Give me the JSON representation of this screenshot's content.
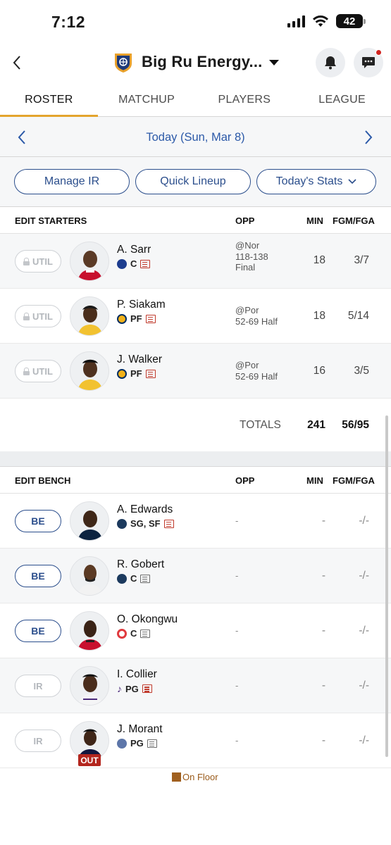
{
  "status_bar": {
    "time": "7:12",
    "battery": "42"
  },
  "header": {
    "team_name": "Big Ru Energy..."
  },
  "tabs": [
    {
      "label": "ROSTER",
      "active": true
    },
    {
      "label": "MATCHUP"
    },
    {
      "label": "PLAYERS"
    },
    {
      "label": "LEAGUE"
    }
  ],
  "date_nav": {
    "label": "Today (Sun, Mar 8)"
  },
  "actions": {
    "manage_ir": "Manage IR",
    "quick_lineup": "Quick Lineup",
    "todays_stats": "Today's Stats"
  },
  "starters": {
    "header": {
      "title": "EDIT STARTERS",
      "opp": "OPP",
      "min": "MIN",
      "fgm_fga": "FGM/FGA"
    },
    "rows": [
      {
        "slot": "UTIL",
        "name": "A. Sarr",
        "pos": "C",
        "team_color": "#1d3d8f",
        "opp_line1": "@Nor",
        "opp_line2": "118-138",
        "opp_line3": "Final",
        "min": "18",
        "fg": "3/7"
      },
      {
        "slot": "UTIL",
        "name": "P. Siakam",
        "pos": "PF",
        "team_color": "#f2b21a",
        "opp_line1": "@Por",
        "opp_line2": "52-69 Half",
        "opp_line3": "",
        "min": "18",
        "fg": "5/14"
      },
      {
        "slot": "UTIL",
        "name": "J. Walker",
        "pos": "PF",
        "team_color": "#f2b21a",
        "opp_line1": "@Por",
        "opp_line2": "52-69 Half",
        "opp_line3": "",
        "min": "16",
        "fg": "3/5"
      }
    ],
    "totals": {
      "label": "TOTALS",
      "min": "241",
      "fg": "56/95"
    }
  },
  "bench": {
    "header": {
      "title": "EDIT BENCH",
      "opp": "OPP",
      "min": "MIN",
      "fgm_fga": "FGM/FGA"
    },
    "rows": [
      {
        "slot": "BE",
        "name": "A. Edwards",
        "pos": "SG, SF",
        "team_color": "#1c3a5e",
        "opp": "-",
        "min": "-",
        "fg": "-/-",
        "news": "red"
      },
      {
        "slot": "BE",
        "name": "R. Gobert",
        "pos": "C",
        "team_color": "#1c3a5e",
        "opp": "-",
        "min": "-",
        "fg": "-/-",
        "news": "gray"
      },
      {
        "slot": "BE",
        "name": "O. Okongwu",
        "pos": "C",
        "team_color": "#e03a3e",
        "opp": "-",
        "min": "-",
        "fg": "-/-",
        "news": "gray"
      },
      {
        "slot": "IR",
        "name": "I. Collier",
        "pos": "PG",
        "team_color": "#4b2a7b",
        "opp": "-",
        "min": "-",
        "fg": "-/-",
        "news": "red"
      },
      {
        "slot": "IR",
        "name": "J. Morant",
        "pos": "PG",
        "team_color": "#5d76a9",
        "opp": "-",
        "min": "-",
        "fg": "-/-",
        "news": "gray",
        "badge": "OUT"
      }
    ]
  },
  "legend": {
    "label": "On Floor",
    "color": "#a0601f"
  }
}
